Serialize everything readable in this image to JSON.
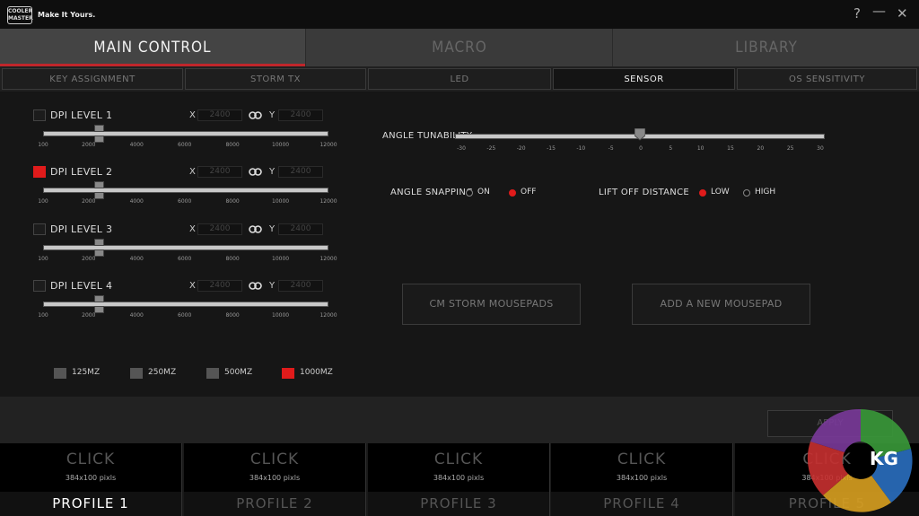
{
  "brand": {
    "logo_text": "COOLER MASTER",
    "tagline": "Make It Yours."
  },
  "window_controls": {
    "help": "?",
    "minimize": "—",
    "close": "✕"
  },
  "main_tabs": [
    "MAIN CONTROL",
    "MACRO",
    "LIBRARY"
  ],
  "sub_tabs": [
    "KEY ASSIGNMENT",
    "STORM TX",
    "LED",
    "SENSOR",
    "OS SENSITIVITY"
  ],
  "dpi_levels": [
    {
      "label": "DPI LEVEL 1",
      "checked": false,
      "x_value": "2400",
      "y_value": "2400",
      "slider_value": 2400
    },
    {
      "label": "DPI LEVEL 2",
      "checked": true,
      "x_value": "2400",
      "y_value": "2400",
      "slider_value": 2400
    },
    {
      "label": "DPI LEVEL 3",
      "checked": false,
      "x_value": "2400",
      "y_value": "2400",
      "slider_value": 2400
    },
    {
      "label": "DPI LEVEL 4",
      "checked": false,
      "x_value": "2400",
      "y_value": "2400",
      "slider_value": 2400
    }
  ],
  "axis_labels": {
    "x": "X",
    "y": "Y"
  },
  "dpi_ticks": [
    "100",
    "2000",
    "4000",
    "6000",
    "8000",
    "10000",
    "12000"
  ],
  "polling_rates": [
    {
      "label": "125MZ",
      "on": false
    },
    {
      "label": "250MZ",
      "on": false
    },
    {
      "label": "500MZ",
      "on": false
    },
    {
      "label": "1000MZ",
      "on": true
    }
  ],
  "angle_tunability": {
    "label": "ANGLE TUNABILITY",
    "value": 0,
    "ticks": [
      "-30",
      "-25",
      "-20",
      "-15",
      "-10",
      "-5",
      "0",
      "5",
      "10",
      "15",
      "20",
      "25",
      "30"
    ]
  },
  "angle_snapping": {
    "label": "ANGLE SNAPPING",
    "options": [
      "ON",
      "OFF"
    ],
    "selected": "OFF"
  },
  "lift_off_distance": {
    "label": "LIFT OFF DISTANCE",
    "options": [
      "LOW",
      "HIGH"
    ],
    "selected": "LOW"
  },
  "mousepad_buttons": {
    "storm": "CM STORM MOUSEPADS",
    "add": "ADD A NEW MOUSEPAD"
  },
  "apply_label": "APPLY",
  "profiles": [
    {
      "click": "CLICK",
      "size": "384x100 pixls",
      "name": "PROFILE 1",
      "active": true
    },
    {
      "click": "CLICK",
      "size": "384x100 pixls",
      "name": "PROFILE 2",
      "active": false
    },
    {
      "click": "CLICK",
      "size": "384x100 pixls",
      "name": "PROFILE 3",
      "active": false
    },
    {
      "click": "CLICK",
      "size": "384x100 pixls",
      "name": "PROFILE 4",
      "active": false
    },
    {
      "click": "CLICK",
      "size": "384x100 pixls",
      "name": "PROFILE 5",
      "active": false
    }
  ],
  "watermark": {
    "text": "KG"
  },
  "colors": {
    "accent": "#e01b1b",
    "tab_underline": "#c0262b"
  }
}
